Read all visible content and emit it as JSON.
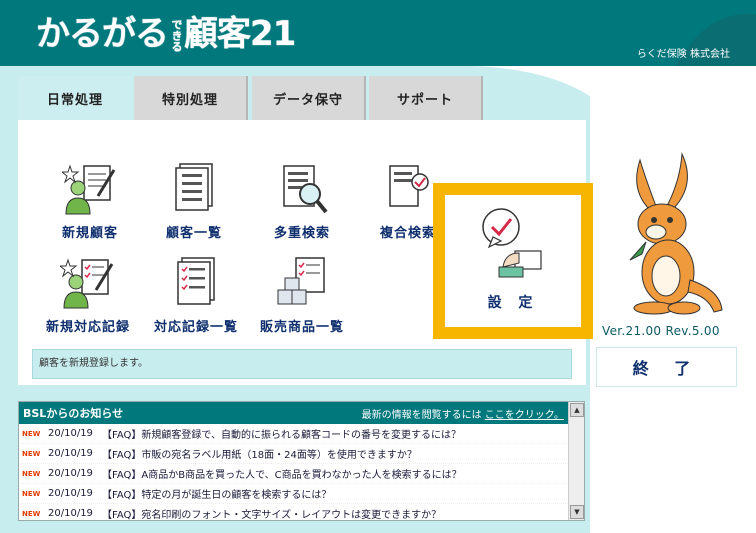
{
  "header": {
    "logo_main": "かるがる",
    "logo_small": "できる",
    "logo_tail": "顧客21",
    "company": "らくだ保険 株式会社"
  },
  "tabs": [
    {
      "label": "日常処理",
      "active": true
    },
    {
      "label": "特別処理",
      "active": false
    },
    {
      "label": "データ保守",
      "active": false
    },
    {
      "label": "サポート",
      "active": false
    }
  ],
  "features": {
    "new_customer": "新規顧客",
    "customer_list": "顧客一覧",
    "multi_search": "多重検索",
    "compound_search": "複合検索",
    "new_record": "新規対応記録",
    "record_list": "対応記録一覧",
    "sales_list": "販売商品一覧",
    "settings": "設 定"
  },
  "status_text": "顧客を新規登録します。",
  "news": {
    "title": "BSLからのお知らせ",
    "lead": "最新の情報を閲覧するには",
    "link": "ここをクリック。",
    "items": [
      {
        "badge": "NEW",
        "date": "20/10/19",
        "title": "【FAQ】新規顧客登録で、自動的に振られる顧客コードの番号を変更するには？"
      },
      {
        "badge": "NEW",
        "date": "20/10/19",
        "title": "【FAQ】市販の宛名ラベル用紙（18面・24面等）を使用できますか？"
      },
      {
        "badge": "NEW",
        "date": "20/10/19",
        "title": "【FAQ】A商品かB商品を買った人で、C商品を買わなかった人を検索するには？"
      },
      {
        "badge": "NEW",
        "date": "20/10/19",
        "title": "【FAQ】特定の月が誕生日の顧客を検索するには？"
      },
      {
        "badge": "NEW",
        "date": "20/10/19",
        "title": "【FAQ】宛名印刷のフォント・文字サイズ・レイアウトは変更できますか？"
      }
    ]
  },
  "version": "Ver.21.00 Rev.5.00",
  "exit_label": "終 了",
  "colors": {
    "teal": "#00787c",
    "panel": "#c8edef",
    "highlight": "#f7b500",
    "label_navy": "#0f2f6e",
    "new_badge": "#e23b00"
  }
}
